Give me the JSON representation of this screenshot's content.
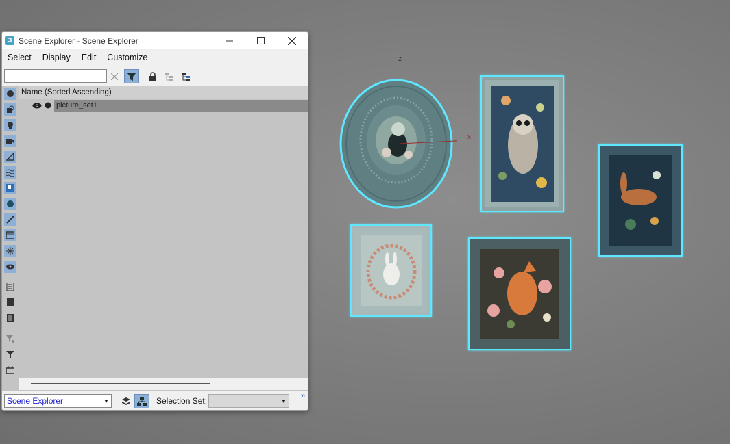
{
  "window": {
    "title": "Scene Explorer - Scene Explorer",
    "app_logo": "3",
    "controls": [
      "minimize-icon",
      "maximize-icon",
      "close-icon"
    ]
  },
  "menu": [
    "Select",
    "Display",
    "Edit",
    "Customize"
  ],
  "toolbar": {
    "search_value": "",
    "icons": [
      "clear-icon",
      "filter-icon",
      "lock-icon",
      "hierarchy-icon",
      "hierarchy-expand-icon"
    ]
  },
  "tree": {
    "column_header": "Name (Sorted Ascending)",
    "rows": [
      {
        "name": "picture_set1",
        "selected": true
      }
    ]
  },
  "bottom": {
    "explorer_select": "Scene Explorer",
    "selection_set_label": "Selection Set:",
    "selection_set_value": "",
    "more": "»"
  },
  "viewport": {
    "axis_z": "z",
    "axis_x": "x",
    "selection_color": "#5fe7ff",
    "frames": [
      "round-frame-frog",
      "frame-owl",
      "frame-hare",
      "frame-rabbit",
      "frame-fox"
    ]
  }
}
